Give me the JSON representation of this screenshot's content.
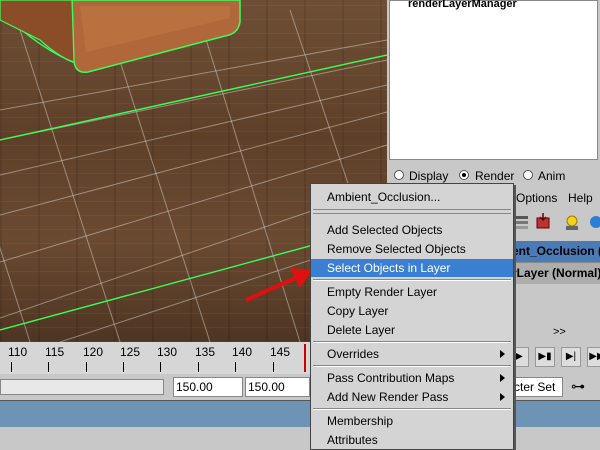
{
  "outliner": {
    "item": "renderLayerManager"
  },
  "layer_editor": {
    "modes": [
      {
        "label": "Display",
        "selected": false
      },
      {
        "label": "Render",
        "selected": true
      },
      {
        "label": "Anim",
        "selected": false
      }
    ],
    "menu": [
      "Options",
      "Help"
    ],
    "layers": [
      {
        "label": "ent_Occlusion (N",
        "selected": true
      },
      {
        "label": "rLayer (Normal)",
        "selected": false
      }
    ],
    "scroll_indicator": ">>"
  },
  "timeline": {
    "ticks": [
      "110",
      "115",
      "120",
      "125",
      "130",
      "135",
      "140",
      "145"
    ]
  },
  "range": {
    "end_a": "150.00",
    "end_b": "150.00"
  },
  "character_set": {
    "label": "cter Set"
  },
  "context_menu": {
    "items": [
      {
        "label": "Ambient_Occlusion...",
        "submenu": false,
        "highlighted": false
      },
      {
        "label": "Add Selected Objects",
        "submenu": false,
        "highlighted": false
      },
      {
        "label": "Remove Selected Objects",
        "submenu": false,
        "highlighted": false
      },
      {
        "label": "Select Objects in Layer",
        "submenu": false,
        "highlighted": true
      },
      {
        "label": "Empty Render Layer",
        "submenu": false,
        "highlighted": false
      },
      {
        "label": "Copy Layer",
        "submenu": false,
        "highlighted": false
      },
      {
        "label": "Delete Layer",
        "submenu": false,
        "highlighted": false
      },
      {
        "label": "Overrides",
        "submenu": true,
        "highlighted": false
      },
      {
        "label": "Pass Contribution Maps",
        "submenu": true,
        "highlighted": false
      },
      {
        "label": "Add New Render Pass",
        "submenu": true,
        "highlighted": false
      },
      {
        "label": "Membership",
        "submenu": false,
        "highlighted": false
      },
      {
        "label": "Attributes",
        "submenu": false,
        "highlighted": false
      }
    ]
  },
  "colors": {
    "highlight": "#3b7fd3",
    "wireframe": "#39ff5a",
    "annotation_arrow": "#e01010"
  }
}
